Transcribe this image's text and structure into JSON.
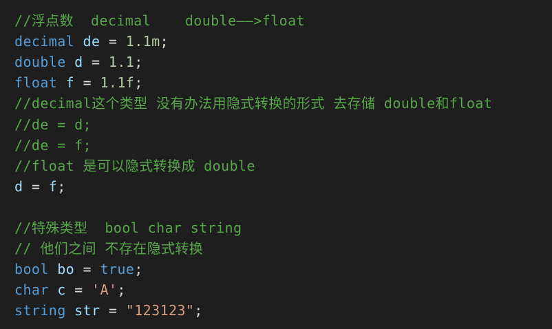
{
  "editor": {
    "lines": [
      [
        {
          "t": "//浮点数  decimal    double——>float",
          "k": "comment"
        }
      ],
      [
        {
          "t": "decimal",
          "k": "keyword"
        },
        {
          "t": " ",
          "k": "plain"
        },
        {
          "t": "de",
          "k": "ident"
        },
        {
          "t": " = ",
          "k": "plain"
        },
        {
          "t": "1.1m",
          "k": "number"
        },
        {
          "t": ";",
          "k": "plain"
        }
      ],
      [
        {
          "t": "double",
          "k": "keyword"
        },
        {
          "t": " ",
          "k": "plain"
        },
        {
          "t": "d",
          "k": "ident"
        },
        {
          "t": " = ",
          "k": "plain"
        },
        {
          "t": "1.1",
          "k": "number"
        },
        {
          "t": ";",
          "k": "plain"
        }
      ],
      [
        {
          "t": "float",
          "k": "keyword"
        },
        {
          "t": " ",
          "k": "plain"
        },
        {
          "t": "f",
          "k": "ident"
        },
        {
          "t": " = ",
          "k": "plain"
        },
        {
          "t": "1.1f",
          "k": "number"
        },
        {
          "t": ";",
          "k": "plain"
        }
      ],
      [
        {
          "t": "//decimal这个类型 没有办法用隐式转换的形式 去存储 double和float",
          "k": "comment"
        }
      ],
      [
        {
          "t": "//de = d;",
          "k": "comment"
        }
      ],
      [
        {
          "t": "//de = f;",
          "k": "comment"
        }
      ],
      [
        {
          "t": "//float 是可以隐式转换成 double",
          "k": "comment"
        }
      ],
      [
        {
          "t": "d",
          "k": "ident"
        },
        {
          "t": " = ",
          "k": "plain"
        },
        {
          "t": "f",
          "k": "ident"
        },
        {
          "t": ";",
          "k": "plain"
        }
      ],
      [],
      [
        {
          "t": "//特殊类型  bool char string",
          "k": "comment"
        }
      ],
      [
        {
          "t": "// 他们之间 不存在隐式转换",
          "k": "comment"
        }
      ],
      [
        {
          "t": "bool",
          "k": "keyword"
        },
        {
          "t": " ",
          "k": "plain"
        },
        {
          "t": "bo",
          "k": "ident"
        },
        {
          "t": " = ",
          "k": "plain"
        },
        {
          "t": "true",
          "k": "keyword"
        },
        {
          "t": ";",
          "k": "plain"
        }
      ],
      [
        {
          "t": "char",
          "k": "keyword"
        },
        {
          "t": " ",
          "k": "plain"
        },
        {
          "t": "c",
          "k": "ident"
        },
        {
          "t": " = ",
          "k": "plain"
        },
        {
          "t": "'A'",
          "k": "string"
        },
        {
          "t": ";",
          "k": "plain"
        }
      ],
      [
        {
          "t": "string",
          "k": "keyword"
        },
        {
          "t": " ",
          "k": "plain"
        },
        {
          "t": "str",
          "k": "ident"
        },
        {
          "t": " = ",
          "k": "plain"
        },
        {
          "t": "\"123123\"",
          "k": "string"
        },
        {
          "t": ";",
          "k": "plain"
        }
      ]
    ]
  },
  "theme": {
    "background": "#1e1e1e",
    "comment": "#57a64a",
    "keyword": "#569cd6",
    "ident": "#9cdcfe",
    "plain": "#dcdcdc",
    "number": "#b5cea8",
    "string": "#d69d85"
  }
}
